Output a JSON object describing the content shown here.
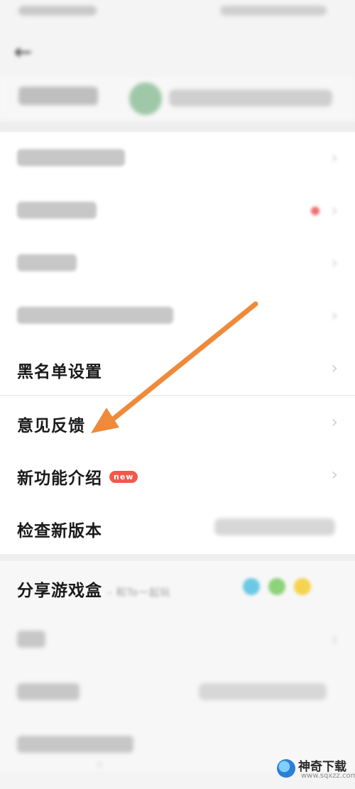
{
  "status_bar": {},
  "header": {
    "back_icon": "back-arrow-icon",
    "title": ""
  },
  "account": {},
  "section2": {
    "items": [
      {
        "label": ""
      },
      {
        "label": ""
      },
      {
        "label": ""
      },
      {
        "label": ""
      },
      {
        "label": "黑名单设置"
      }
    ]
  },
  "section3": {
    "feedback": {
      "label": "意见反馈"
    },
    "new_features": {
      "label": "新功能介绍",
      "badge": "new"
    },
    "check_update": {
      "label": "检查新版本"
    }
  },
  "section4": {
    "share": {
      "label": "分享游戏盒",
      "subtitle": "- 和To一起玩"
    },
    "items": [
      {
        "label": ""
      },
      {
        "label": ""
      },
      {
        "label": ""
      }
    ]
  },
  "watermark": {
    "name": "神奇下载",
    "url": "www.sqxzz.com"
  },
  "colors": {
    "annotation_arrow": "#ef8a3a",
    "badge_bg": "#f2594b",
    "page_bg": "#f4f4f4",
    "row_bg": "#ffffff"
  }
}
